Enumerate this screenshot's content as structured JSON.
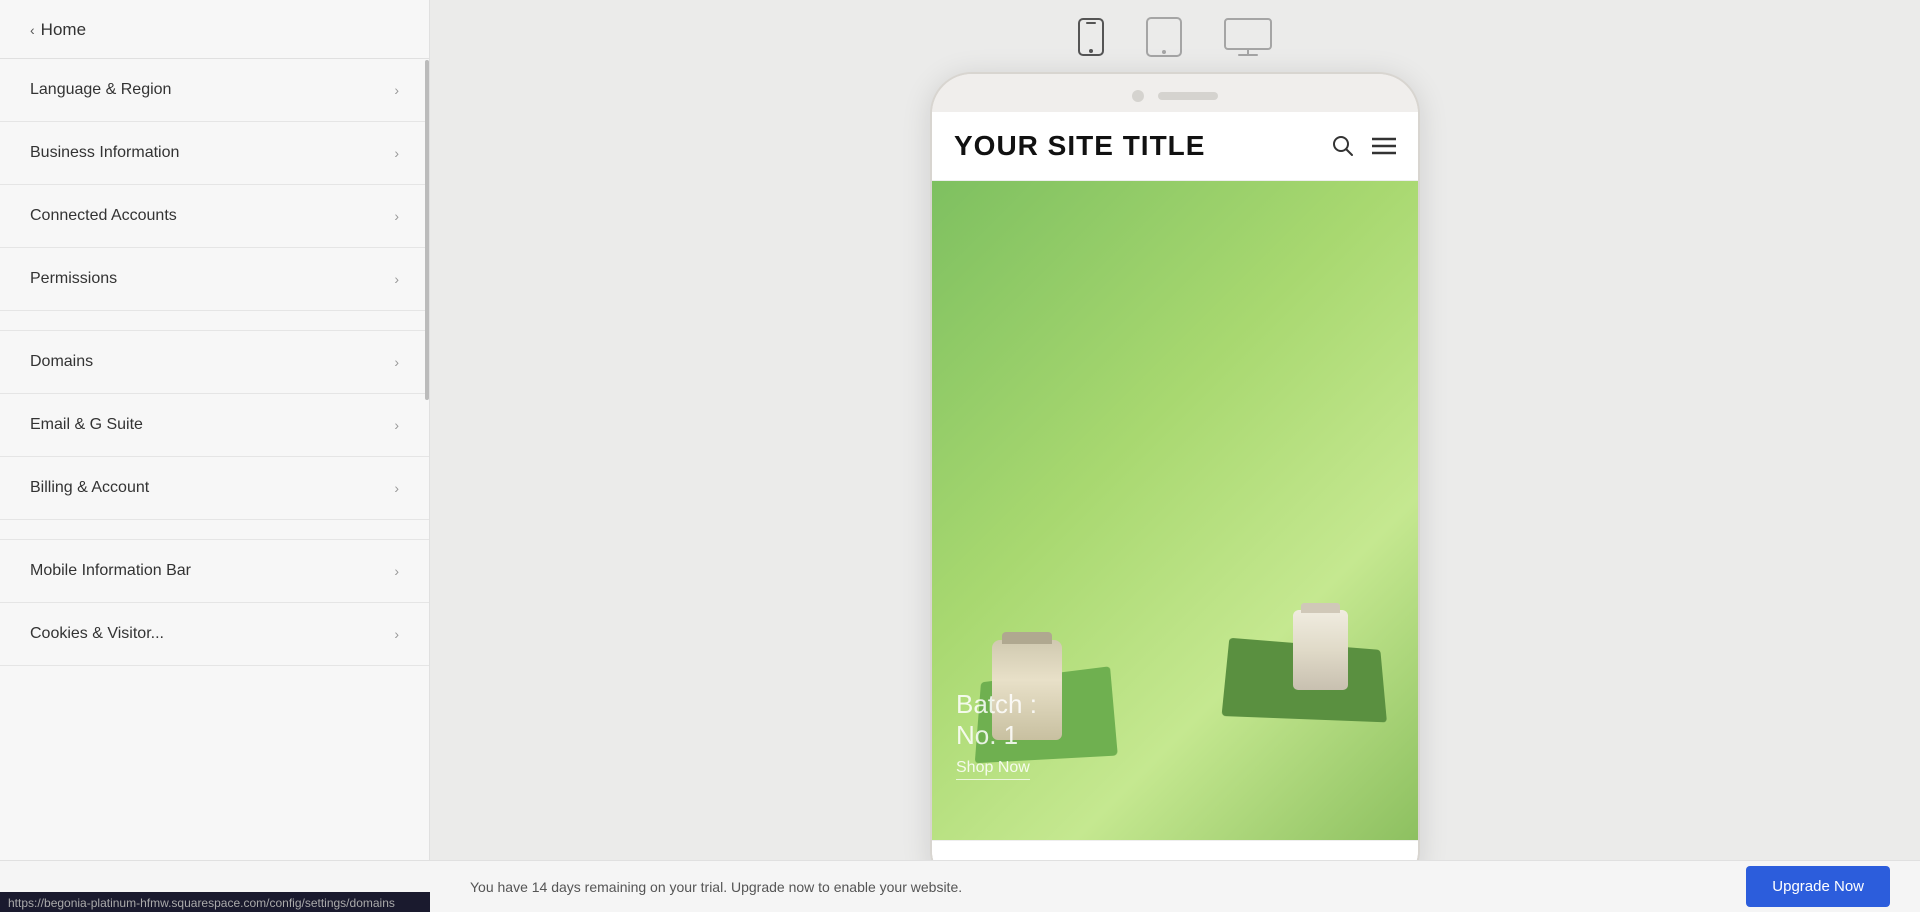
{
  "sidebar": {
    "home_label": "Home",
    "items": [
      {
        "id": "language-region",
        "label": "Language & Region"
      },
      {
        "id": "business-information",
        "label": "Business Information"
      },
      {
        "id": "connected-accounts",
        "label": "Connected Accounts"
      },
      {
        "id": "permissions",
        "label": "Permissions"
      },
      {
        "id": "domains",
        "label": "Domains"
      },
      {
        "id": "email-g-suite",
        "label": "Email & G Suite"
      },
      {
        "id": "billing-account",
        "label": "Billing & Account"
      },
      {
        "id": "mobile-information-bar",
        "label": "Mobile Information Bar"
      },
      {
        "id": "cookies-visitor",
        "label": "Cookies & Visitor..."
      }
    ]
  },
  "device_toolbar": {
    "mobile_label": "mobile",
    "tablet_label": "tablet",
    "desktop_label": "desktop"
  },
  "phone_preview": {
    "site_title": "YOUR SITE TITLE",
    "hero": {
      "batch_label": "Batch :",
      "batch_number": "No. 1",
      "shop_now": "Shop Now"
    }
  },
  "bottom_bar": {
    "trial_message": "You have 14 days remaining on your trial. Upgrade now to enable your website.",
    "upgrade_button": "Upgrade Now"
  },
  "status_url": "https://begonia-platinum-hfmw.squarespace.com/config/settings/domains"
}
